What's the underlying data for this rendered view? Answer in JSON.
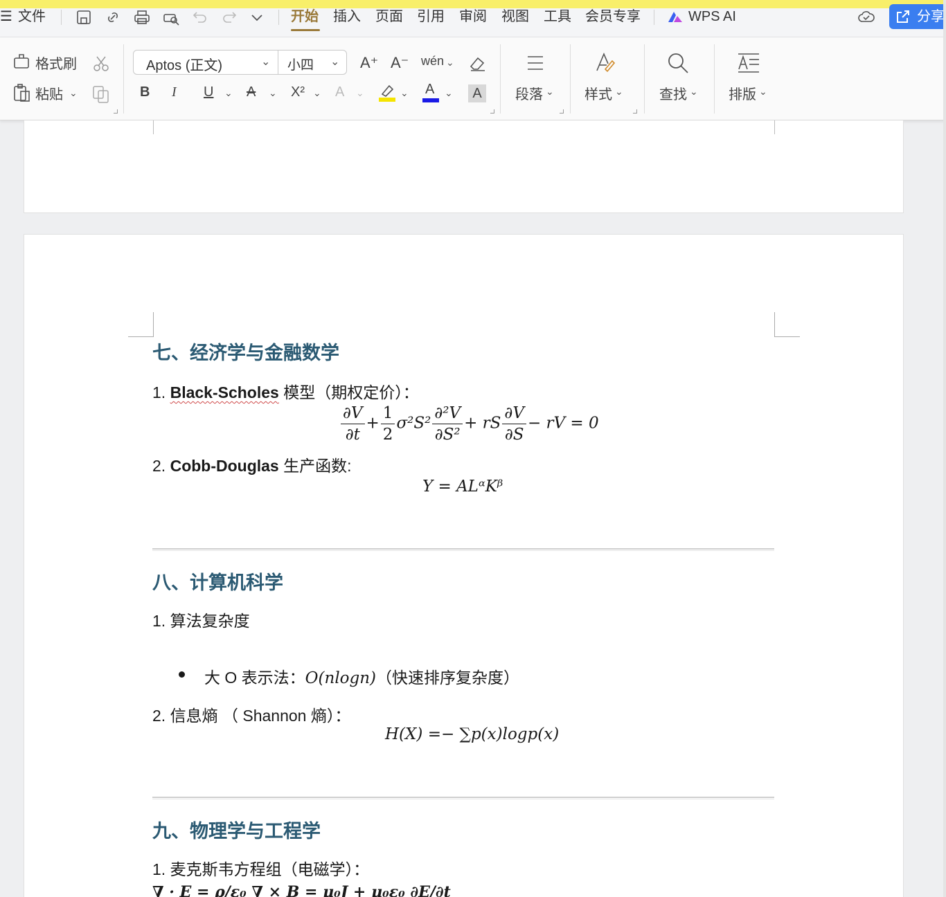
{
  "menubar": {
    "hamburger": "☰",
    "file_label": "文件",
    "tabs": [
      "开始",
      "插入",
      "页面",
      "引用",
      "审阅",
      "视图",
      "工具",
      "会员专享"
    ],
    "active_tab": "开始",
    "wps_ai_label": "WPS AI",
    "share_label": "分享"
  },
  "toolbar": {
    "format_painter": "格式刷",
    "paste": "粘贴",
    "font_name": "Aptos (正文)",
    "font_size": "小四",
    "bold": "B",
    "italic": "I",
    "underline": "U",
    "strike": "A",
    "superscript": "X²",
    "text_effect": "A",
    "font_color": "A",
    "char_shading": "A",
    "paragraph": "段落",
    "styles": "样式",
    "find": "查找",
    "layout": "排版",
    "grow_font": "A⁺",
    "shrink_font": "A⁻",
    "pinyin": "wén",
    "colors": {
      "highlight": "#f5e400",
      "font_color": "#1a1ae6",
      "accent": "#9a7a3a",
      "share_bg": "#3a7ef0"
    }
  },
  "document": {
    "section7": {
      "heading": "七、经济学与金融数学",
      "item1_prefix": "1. ",
      "item1_bold": "Black-Scholes",
      "item1_rest": " 模型（期权定价）：",
      "bs_eq": {
        "dv": "∂V",
        "dt": "∂t",
        "plus1": "+",
        "one": "1",
        "two": "2",
        "sigma2s2": "σ²S²",
        "d2v": "∂²V",
        "ds2": "∂S²",
        "plus_rs": "+ rS",
        "dv2": "∂V",
        "ds": "∂S",
        "tail": "− rV = 0"
      },
      "item2_prefix": "2. ",
      "item2_bold": "Cobb-Douglas",
      "item2_rest": " 生产函数:",
      "cd_eq": "Y = ALᵅKᵝ"
    },
    "section8": {
      "heading": "八、计算机科学",
      "item1": "1. 算法复杂度",
      "bullet_prefix": "大 O 表示法：",
      "bullet_math": "O(nlogn)",
      "bullet_rest": "（快速排序复杂度）",
      "item2": "2. 信息熵 （ Shannon 熵）：",
      "entropy_eq": "H(X) =− ∑p(x)logp(x)"
    },
    "section9": {
      "heading": "九、物理学与工程学",
      "item1": "1. 麦克斯韦方程组（电磁学）：",
      "maxwell_partial": "∇ · E = ρ/ε₀    ∇ × B = μ₀J + μ₀ε₀ ∂E/∂t"
    }
  }
}
